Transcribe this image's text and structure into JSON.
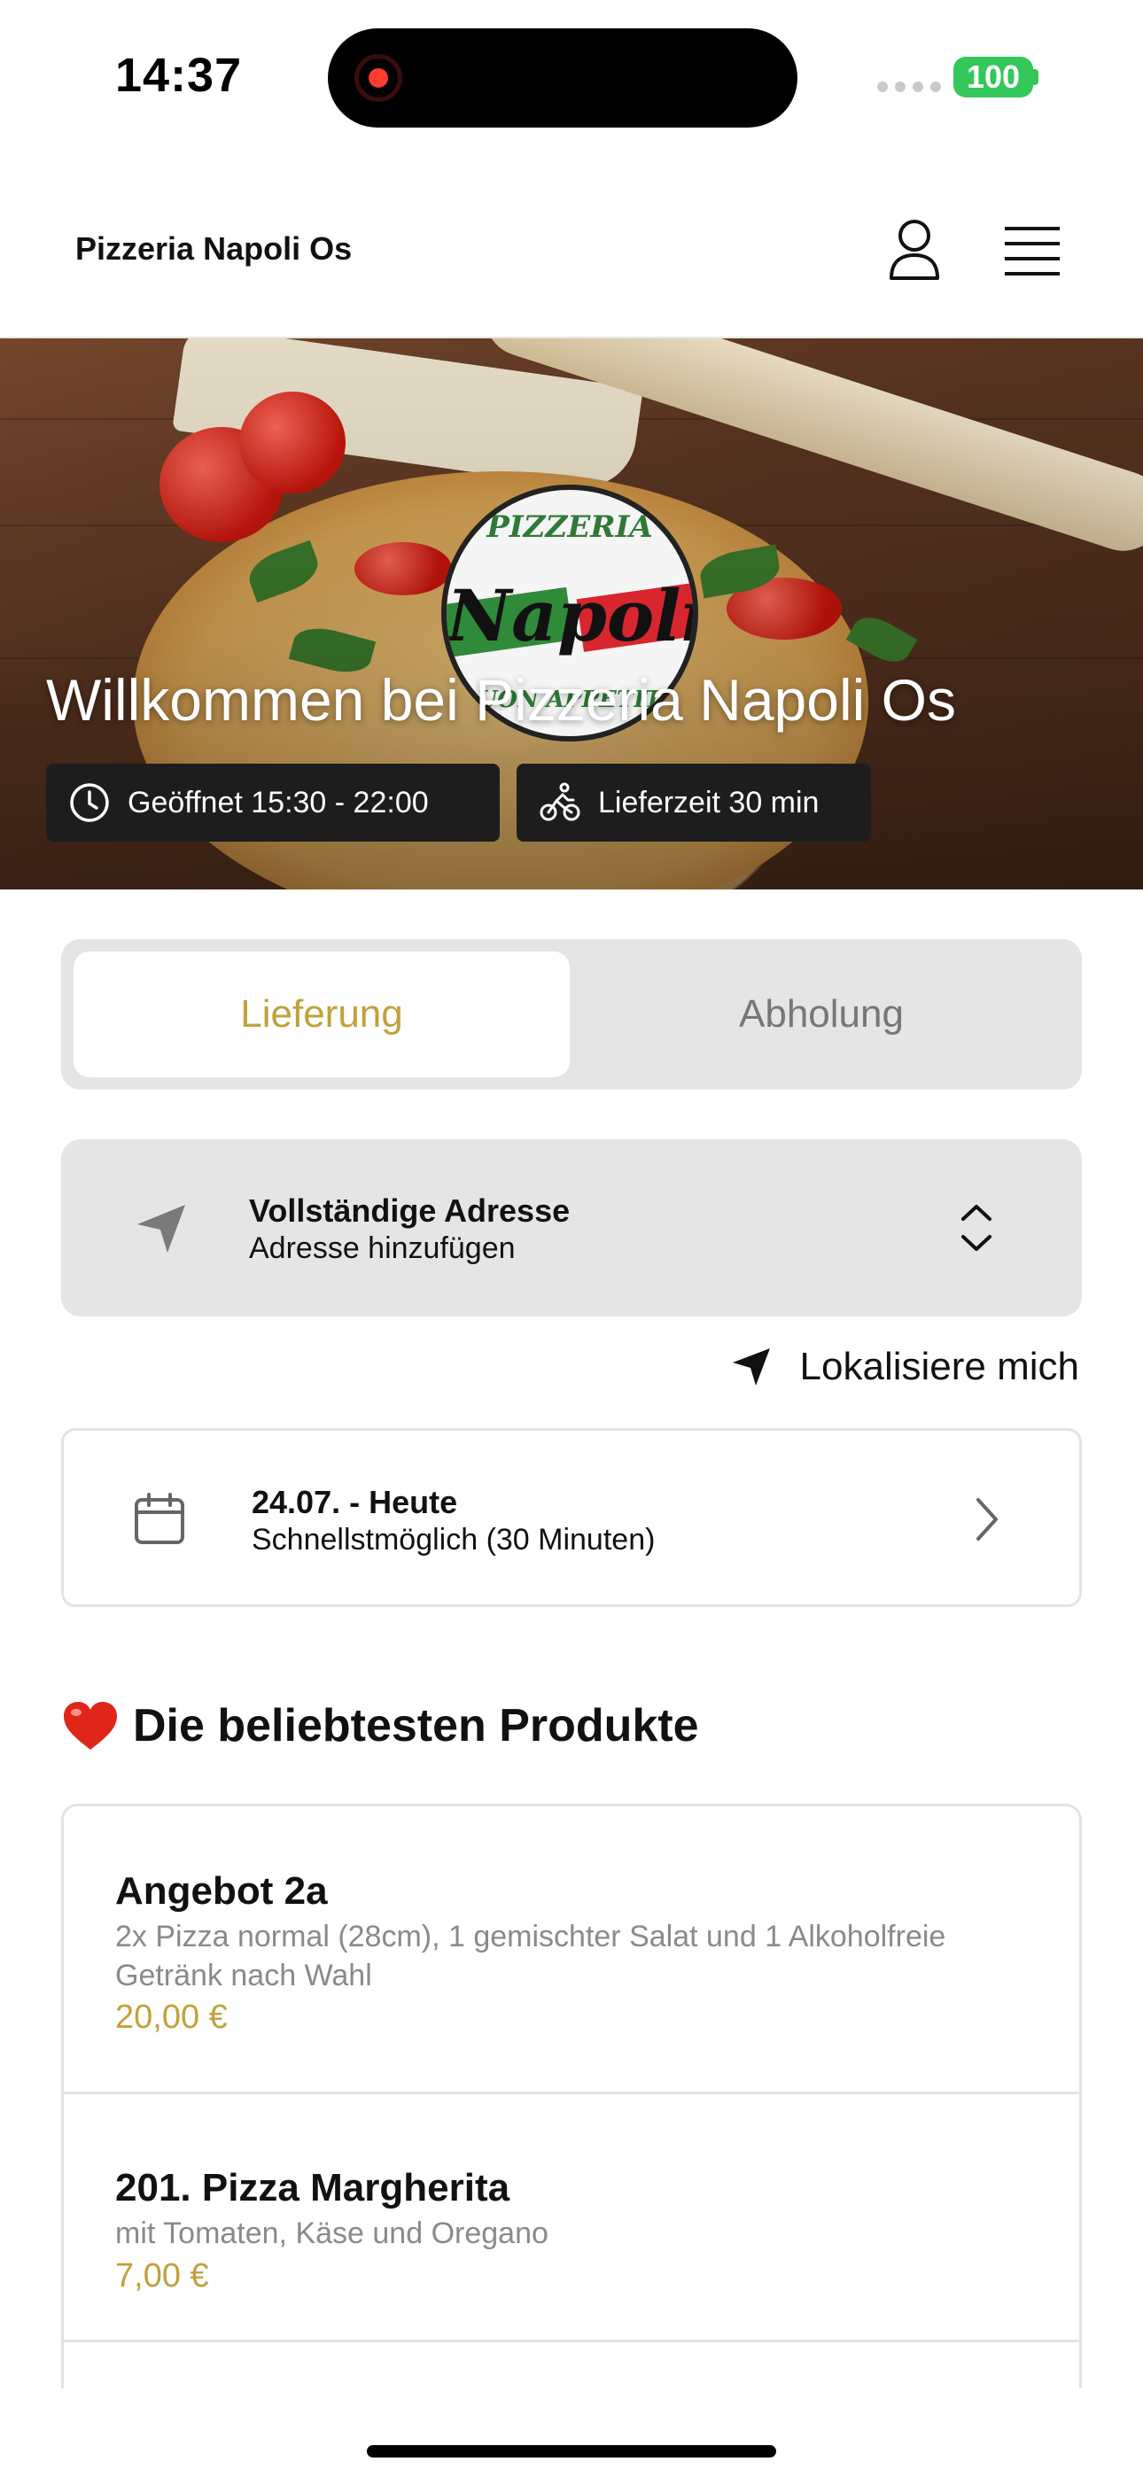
{
  "status_bar": {
    "time": "14:37",
    "battery": "100",
    "colors": {
      "battery": "#34c759",
      "recording": "#ff3b30"
    }
  },
  "header": {
    "title": "Pizzeria Napoli Os",
    "icons": [
      "user-icon",
      "menu-icon"
    ]
  },
  "hero": {
    "welcome": "Willkommen bei Pizzeria Napoli Os",
    "logo": {
      "top": "PIZZERIA",
      "main": "Napoli",
      "bottom": "BUON APPETITO"
    },
    "opening_hours": "Geöffnet 15:30 - 22:00",
    "delivery_time": "Lieferzeit 30 min",
    "icons": [
      "clock-icon",
      "cyclist-icon"
    ]
  },
  "order_mode": {
    "options": [
      "Lieferung",
      "Abholung"
    ],
    "selected": "Lieferung",
    "accent_color": "#c2a13c"
  },
  "address": {
    "title": "Vollständige Adresse",
    "subtitle": "Adresse hinzufügen",
    "icons": [
      "location-arrow-icon",
      "chevron-up-down-icon"
    ]
  },
  "locate": {
    "label": "Lokalisiere mich",
    "icon": "location-arrow-icon"
  },
  "schedule": {
    "date": "24.07. - Heute",
    "time": "Schnellstmöglich (30 Minuten)",
    "icons": [
      "calendar-icon",
      "chevron-right-icon"
    ]
  },
  "popular": {
    "heading_emoji": "heart-icon",
    "heading": "Die beliebtesten Produkte",
    "products": [
      {
        "name": "Angebot 2a",
        "description": "2x Pizza normal (28cm), 1 gemischter Salat und 1 Alkoholfreie Getränk nach Wahl",
        "price": "20,00 €"
      },
      {
        "name": "201. Pizza Margherita",
        "description": "mit Tomaten, Käse und Oregano",
        "price": "7,00 €"
      }
    ]
  }
}
